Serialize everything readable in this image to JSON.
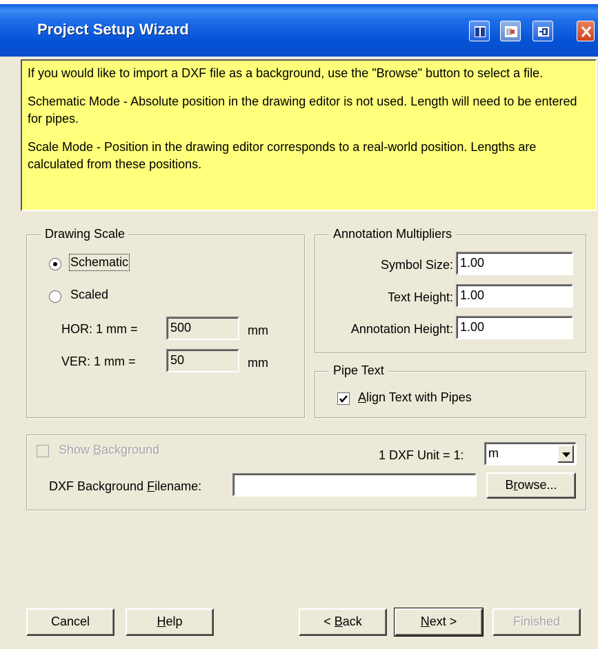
{
  "window": {
    "title": "Project Setup Wizard"
  },
  "info": {
    "lines": [
      "If you would like to import a DXF file as a background, use the \"Browse\" button to select a file.",
      "Schematic Mode - Absolute position in the drawing editor is not used. Length will need to be entered for pipes.",
      "Scale Mode - Position in the drawing editor corresponds to a real-world position. Lengths are calculated from these positions."
    ]
  },
  "drawing_scale": {
    "label": "Drawing Scale",
    "schematic": "Schematic",
    "scaled": "Scaled",
    "selected": "Schematic",
    "hor_label": "HOR: 1 mm =",
    "hor_value": "500",
    "hor_unit": "mm",
    "ver_label": "VER: 1 mm =",
    "ver_value": "50",
    "ver_unit": "mm"
  },
  "annotation": {
    "label": "Annotation Multipliers",
    "symbol_size_label": "Symbol Size:",
    "symbol_size": "1.00",
    "text_height_label": "Text Height:",
    "text_height": "1.00",
    "annotation_height_label": "Annotation Height:",
    "annotation_height": "1.00"
  },
  "pipe_text": {
    "label": "Pipe Text",
    "align_label_pre": "",
    "align_label_u": "A",
    "align_label_post": "lign Text with Pipes",
    "align_checked": true
  },
  "background": {
    "show_pre": "Show ",
    "show_u": "B",
    "show_post": "ackground",
    "show_checked": false,
    "unit_label": "1 DXF Unit = 1:",
    "unit_value": "m",
    "filename_pre": "DXF Background ",
    "filename_u": "F",
    "filename_post": "ilename:",
    "filename_value": "",
    "browse_pre": "B",
    "browse_u": "r",
    "browse_post": "owse..."
  },
  "buttons": {
    "cancel": "Cancel",
    "help_u": "H",
    "help_post": "elp",
    "back_pre": "< ",
    "back_u": "B",
    "back_post": "ack",
    "next_u": "N",
    "next_post": "ext >",
    "finished": "Finished"
  },
  "colors": {
    "info_bg": "#ffff7b",
    "title_bar": "#0453d6",
    "window_bg": "#ece9d8"
  }
}
